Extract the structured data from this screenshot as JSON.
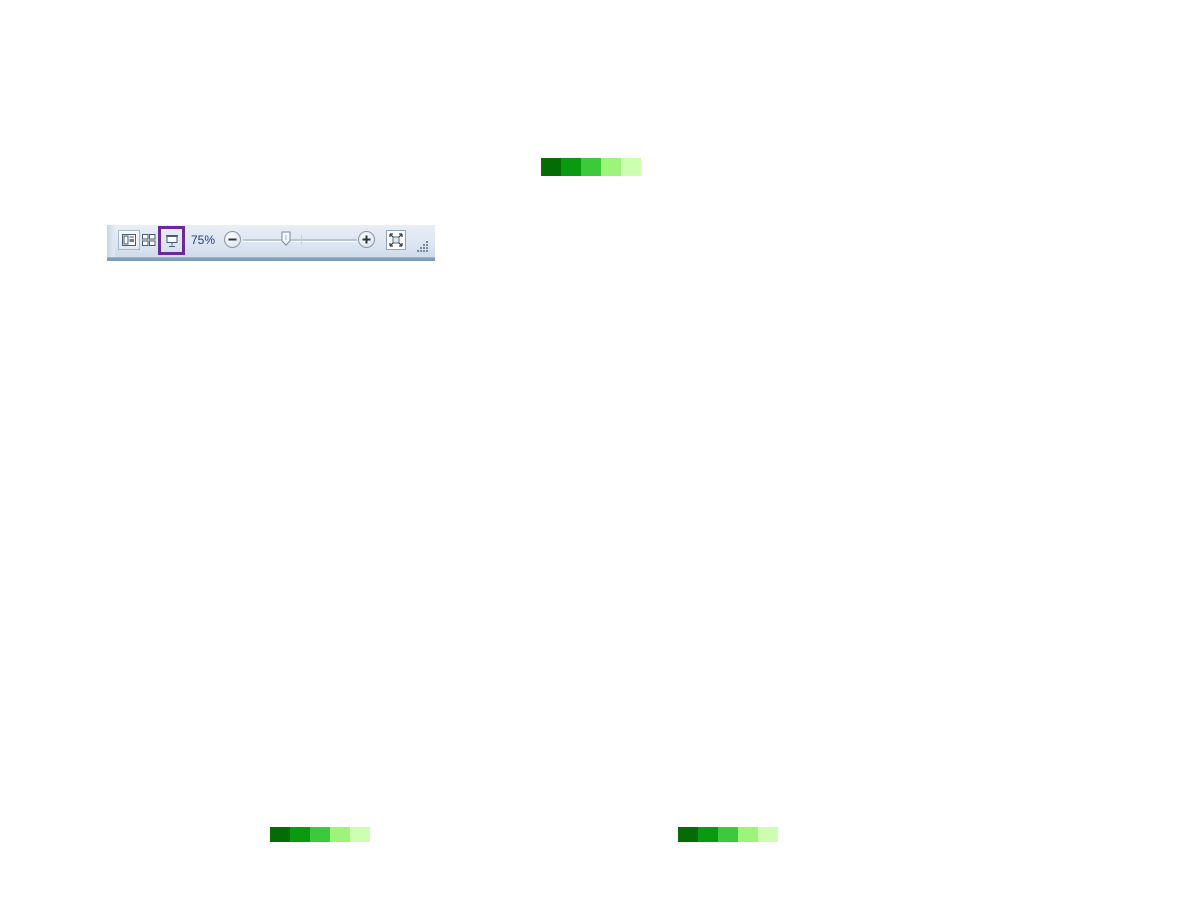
{
  "colors": {
    "green_strip": [
      "#056c05",
      "#0a9a12",
      "#3cc93c",
      "#9cf57a",
      "#ccffb0"
    ],
    "highlight_border": "#6a2a9e",
    "zoom_text": "#1f3f7a"
  },
  "statusbar": {
    "zoom_level": "75%",
    "icons": {
      "normal_view": "normal-view-icon",
      "slide_sorter": "slide-sorter-icon",
      "slide_show": "slide-show-icon",
      "zoom_out": "minus-icon",
      "zoom_in": "plus-icon",
      "fit_to_window": "fit-window-icon",
      "resize_grip": "resize-grip-icon"
    }
  }
}
